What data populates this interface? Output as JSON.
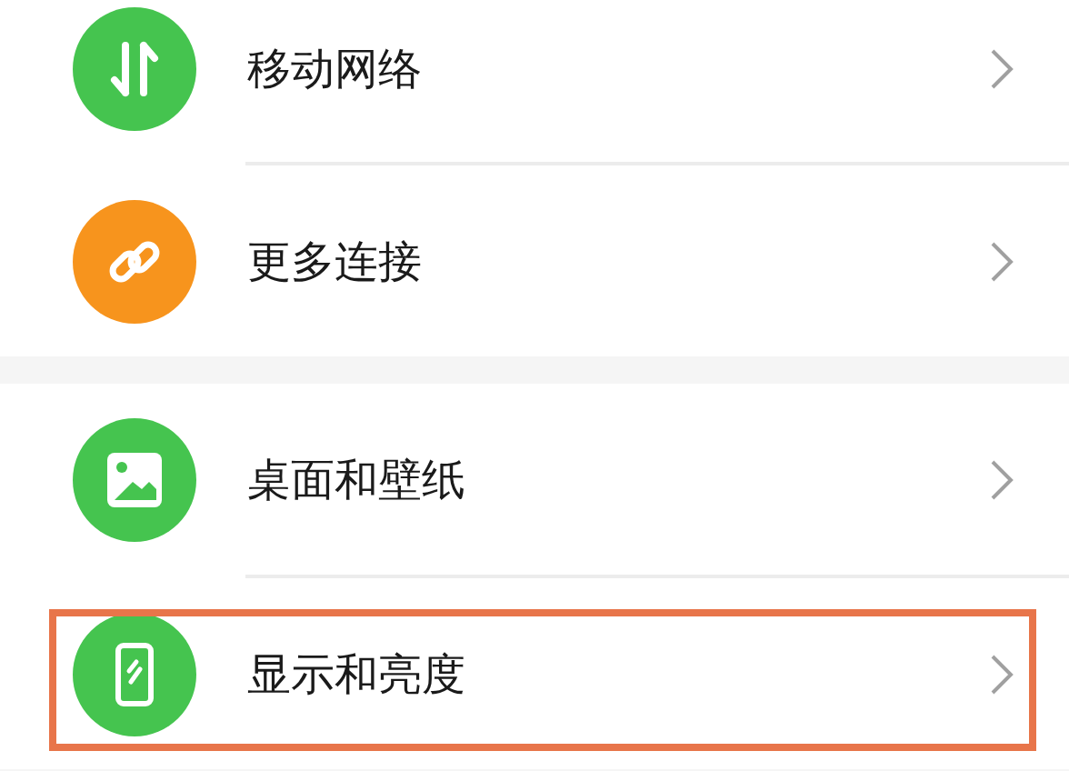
{
  "sections": [
    {
      "items": [
        {
          "kind": "network",
          "label": "移动网络",
          "color": "#45c44f",
          "highlighted": false
        },
        {
          "kind": "link",
          "label": "更多连接",
          "color": "#f7941d",
          "highlighted": false
        }
      ]
    },
    {
      "items": [
        {
          "kind": "wallpaper",
          "label": "桌面和壁纸",
          "color": "#45c44f",
          "highlighted": false
        },
        {
          "kind": "display",
          "label": "显示和亮度",
          "color": "#45c44f",
          "highlighted": true
        }
      ]
    }
  ]
}
